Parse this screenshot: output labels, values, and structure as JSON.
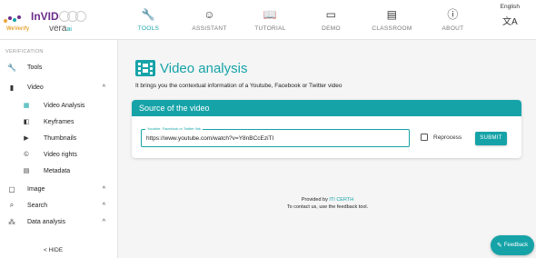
{
  "brand": {
    "top": "InVID",
    "bottom": "WeVerify",
    "vera": "vera",
    "vera_suffix": "ai"
  },
  "colors": {
    "accent": "#16a3a8",
    "brand_purple": "#6b2d8a",
    "brand_orange": "#e8a63a"
  },
  "tabs": [
    {
      "label": "TOOLS",
      "icon": "wrench-icon",
      "glyph": "🔧",
      "active": true
    },
    {
      "label": "ASSISTANT",
      "icon": "robot-icon",
      "glyph": "☺",
      "active": false
    },
    {
      "label": "TUTORIAL",
      "icon": "book-icon",
      "glyph": "📖",
      "active": false
    },
    {
      "label": "DEMO",
      "icon": "video-icon",
      "glyph": "▭",
      "active": false
    },
    {
      "label": "CLASSROOM",
      "icon": "classroom-icon",
      "glyph": "▤",
      "active": false
    },
    {
      "label": "ABOUT",
      "icon": "info-icon",
      "glyph": "ⓘ",
      "active": false
    }
  ],
  "language": {
    "label": "English",
    "icon": "translate-icon"
  },
  "sidebar": {
    "heading": "VERIFICATION",
    "items": [
      {
        "label": "Tools",
        "icon": "wrench-icon",
        "glyph": "🔧"
      },
      {
        "label": "Video",
        "icon": "film-icon",
        "glyph": "▮",
        "chevron": "^"
      },
      {
        "label": "Video Analysis",
        "icon": "video-analysis-icon",
        "glyph": "▦",
        "sub": true,
        "active": true
      },
      {
        "label": "Keyframes",
        "icon": "keyframes-icon",
        "glyph": "◧",
        "sub": true
      },
      {
        "label": "Thumbnails",
        "icon": "youtube-icon",
        "glyph": "▶",
        "sub": true
      },
      {
        "label": "Video rights",
        "icon": "copyright-icon",
        "glyph": "©",
        "sub": true
      },
      {
        "label": "Metadata",
        "icon": "file-icon",
        "glyph": "▤",
        "sub": true
      },
      {
        "label": "Image",
        "icon": "image-icon",
        "glyph": "▢",
        "chevron": "^"
      },
      {
        "label": "Search",
        "icon": "search-icon",
        "glyph": "⌕",
        "chevron": "^"
      },
      {
        "label": "Data analysis",
        "icon": "data-analysis-icon",
        "glyph": "⁂",
        "chevron": "^"
      }
    ],
    "hide_label": "< HIDE"
  },
  "main": {
    "title": "Video analysis",
    "subtitle": "It brings you the contextual information of a Youtube, Facebook or Twitter video",
    "card_title": "Source of the video",
    "field_label": "Youtube, Facebook or Twitter link",
    "field_value": "https://www.youtube.com/watch?v=Y8nBCcEziTI",
    "reprocess_label": "Reprocess",
    "submit_label": "SUBMIT",
    "footer_provided": "Provided by",
    "footer_link": "ITI CERTH",
    "footer_contact": "To contact us, use the feedback tool."
  },
  "feedback_label": "Feedback"
}
